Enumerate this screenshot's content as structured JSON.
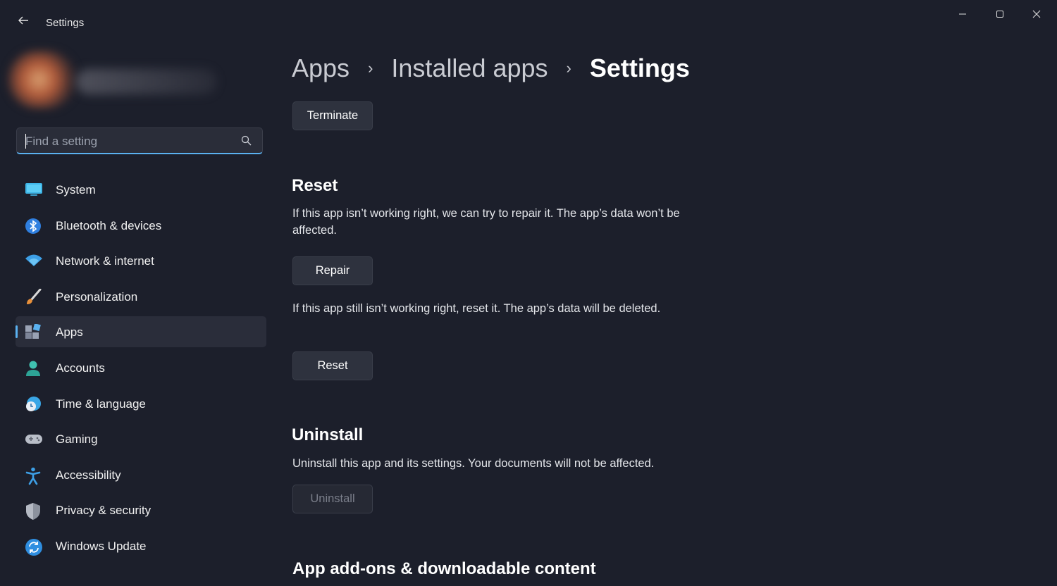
{
  "window": {
    "title": "Settings",
    "back_icon": "back-arrow-icon",
    "controls": [
      "minimize-icon",
      "maximize-icon",
      "close-icon"
    ]
  },
  "search": {
    "placeholder": "Find a setting",
    "icon": "search-icon"
  },
  "sidebar": {
    "items": [
      {
        "label": "System",
        "icon": "system-icon"
      },
      {
        "label": "Bluetooth & devices",
        "icon": "bluetooth-icon"
      },
      {
        "label": "Network & internet",
        "icon": "wifi-icon"
      },
      {
        "label": "Personalization",
        "icon": "brush-icon"
      },
      {
        "label": "Apps",
        "icon": "apps-icon",
        "selected": true
      },
      {
        "label": "Accounts",
        "icon": "person-icon"
      },
      {
        "label": "Time & language",
        "icon": "clock-globe-icon"
      },
      {
        "label": "Gaming",
        "icon": "gamepad-icon"
      },
      {
        "label": "Accessibility",
        "icon": "accessibility-icon"
      },
      {
        "label": "Privacy & security",
        "icon": "shield-icon"
      },
      {
        "label": "Windows Update",
        "icon": "update-icon"
      }
    ]
  },
  "breadcrumb": {
    "items": [
      "Apps",
      "Installed apps",
      "Settings"
    ],
    "separator": "›"
  },
  "main": {
    "terminate_label": "Terminate",
    "reset_section": {
      "title": "Reset",
      "repair_desc": "If this app isn’t working right, we can try to repair it. The app’s data won’t be affected.",
      "repair_label": "Repair",
      "reset_desc": "If this app still isn’t working right, reset it. The app’s data will be deleted.",
      "reset_label": "Reset"
    },
    "uninstall_section": {
      "title": "Uninstall",
      "desc": "Uninstall this app and its settings. Your documents will not be affected.",
      "uninstall_label": "Uninstall"
    },
    "addons_title": "App add-ons & downloadable content"
  },
  "colors": {
    "background": "#1c1f2b",
    "accent": "#5ab1f0",
    "button": "#2e323e"
  }
}
